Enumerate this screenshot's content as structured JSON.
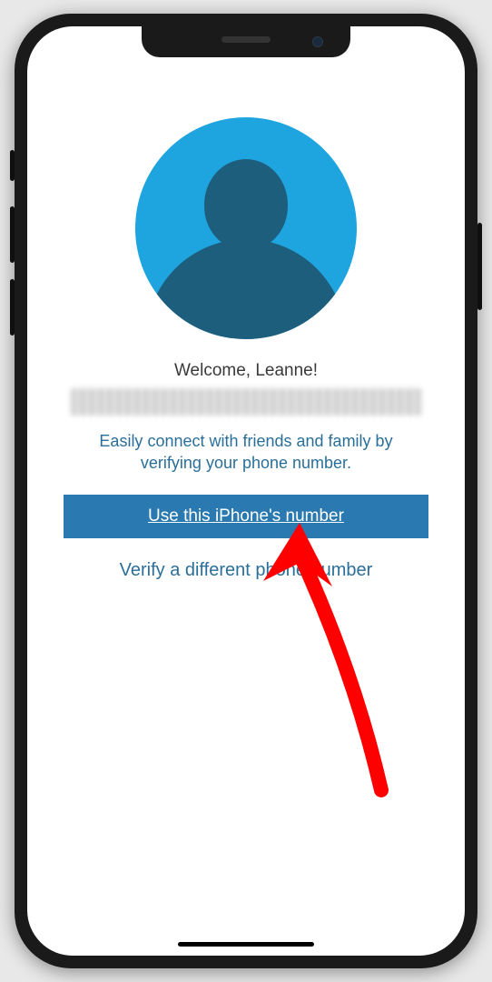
{
  "welcome_text": "Welcome, Leanne!",
  "description": "Easily connect with friends and family by verifying your phone number.",
  "primary_button_label": "Use this iPhone's number",
  "secondary_link_label": "Verify a different phone number",
  "colors": {
    "accent": "#2a79b0",
    "avatar_bg": "#1ea5e0",
    "avatar_fg": "#1e5e7d",
    "text_link": "#2a6f99"
  },
  "annotation": {
    "arrow_color": "#ff0000",
    "arrow_target": "primary-button"
  }
}
